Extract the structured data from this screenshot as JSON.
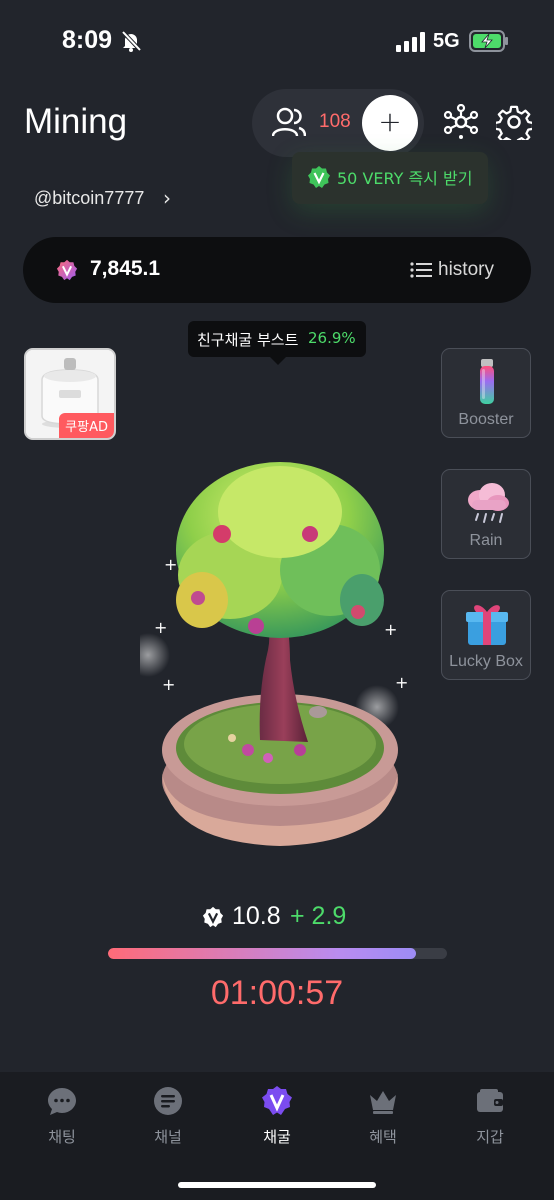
{
  "status_bar": {
    "time": "8:09",
    "network": "5G"
  },
  "header": {
    "title": "Mining",
    "friends_count": "108",
    "add_label": "+",
    "username": "@bitcoin7777",
    "username_chevron": "›"
  },
  "promo": {
    "text": "50 VERY 즉시 받기"
  },
  "balance": {
    "value": "7,845.1",
    "history_label": "history",
    "badge": "V"
  },
  "boost": {
    "label": "친구채굴 부스트",
    "value": "26.9%"
  },
  "ad": {
    "label": "쿠팡AD"
  },
  "tools": [
    {
      "label": "Booster",
      "icon": "booster-icon"
    },
    {
      "label": "Rain",
      "icon": "rain-cloud-icon"
    },
    {
      "label": "Lucky Box",
      "icon": "gift-box-icon"
    }
  ],
  "mining": {
    "rate": "10.8",
    "bonus": "+ 2.9",
    "progress_fraction": 0.91,
    "timer": "01:00:57"
  },
  "tabs": [
    {
      "label": "채팅",
      "icon": "chat-bubble-icon",
      "active": false
    },
    {
      "label": "채널",
      "icon": "channel-icon",
      "active": false
    },
    {
      "label": "채굴",
      "icon": "very-logo-icon",
      "active": true
    },
    {
      "label": "혜택",
      "icon": "crown-icon",
      "active": false
    },
    {
      "label": "지갑",
      "icon": "wallet-icon",
      "active": false
    }
  ],
  "colors": {
    "background": "#22252c",
    "accent_green": "#4ddb6a",
    "accent_red": "#ff6b6b",
    "brand_purple": "#7b4cf0"
  }
}
